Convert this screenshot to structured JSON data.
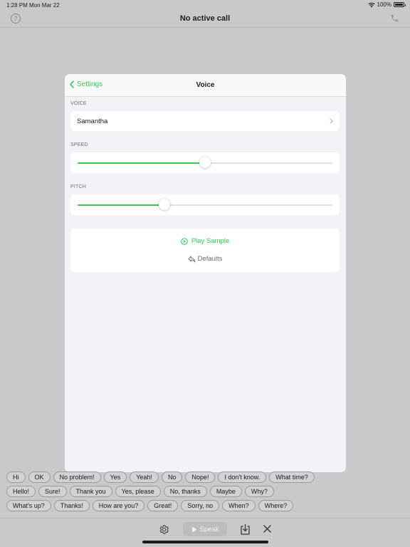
{
  "status_bar": {
    "time": "1:28 PM",
    "date": "Mon Mar 22",
    "battery": "100%",
    "wifi_icon": "wifi-icon",
    "battery_icon": "battery-icon"
  },
  "nav": {
    "title": "No active call",
    "help_label": "?",
    "help_icon": "question-circle-icon",
    "phone_icon": "phone-icon"
  },
  "modal": {
    "back_label": "Settings",
    "title": "Voice",
    "voice_section": "VOICE",
    "voice_value": "Samantha",
    "speed_section": "SPEED",
    "speed_value": 0.5,
    "pitch_section": "PITCH",
    "pitch_value": 0.34,
    "play_sample": "Play Sample",
    "defaults": "Defaults"
  },
  "phrases": [
    [
      "Hi",
      "OK",
      "No problem!",
      "Yes",
      "Yeah!",
      "No",
      "Nope!",
      "I don't know.",
      "What time?"
    ],
    [
      "Hello!",
      "Sure!",
      "Thank you",
      "Yes, please",
      "No, thanks",
      "Maybe",
      "Why?"
    ],
    [
      "What's up?",
      "Thanks!",
      "How are you?",
      "Great!",
      "Sorry, no",
      "When?",
      "Where?"
    ]
  ],
  "toolbar": {
    "speak_label": "Speak",
    "gear_icon": "gear-icon",
    "play_icon": "play-icon",
    "download_icon": "tray-download-icon",
    "close_icon": "close-icon"
  },
  "colors": {
    "accent": "#34c759",
    "background": "#c9c9cb"
  }
}
